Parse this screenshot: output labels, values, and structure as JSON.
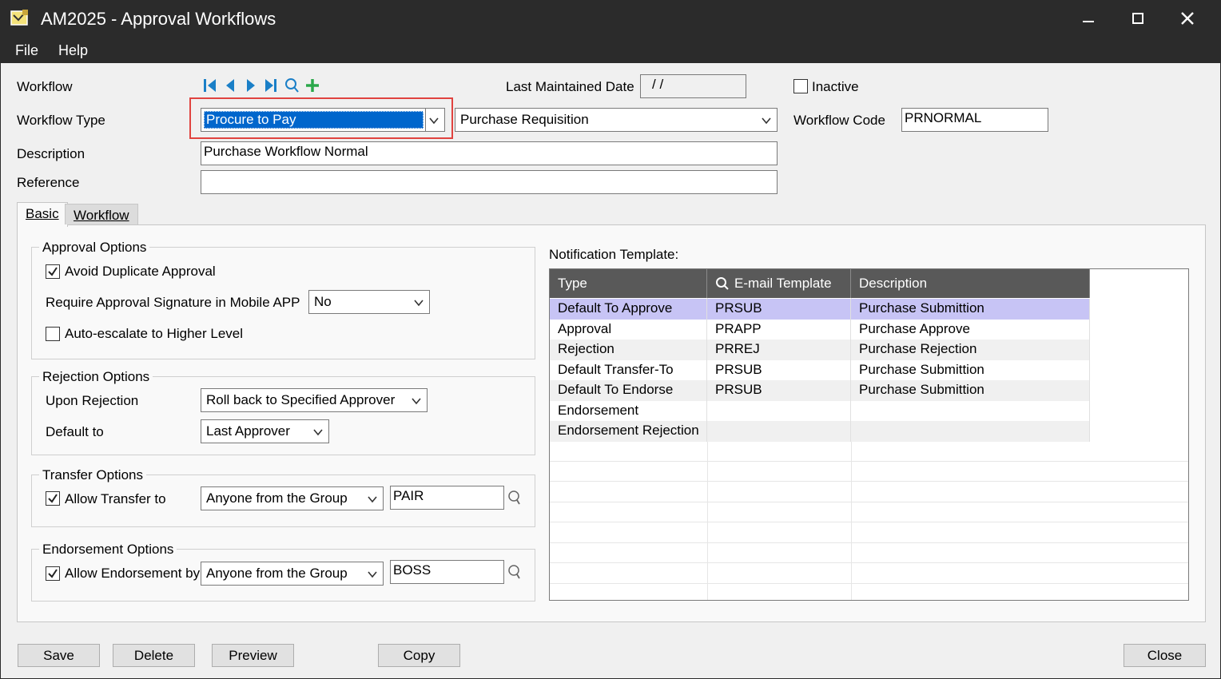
{
  "window": {
    "title": "AM2025 - Approval Workflows",
    "controls": {
      "minimize": "—",
      "maximize": "☐",
      "close": "✕"
    }
  },
  "menu": {
    "file": "File",
    "help": "Help"
  },
  "header": {
    "workflow_label": "Workflow",
    "workflow_type_label": "Workflow Type",
    "workflow_type_value": "Procure to Pay",
    "workflow_subtype_value": "Purchase Requisition",
    "description_label": "Description",
    "description_value": "Purchase Workflow Normal",
    "reference_label": "Reference",
    "reference_value": "",
    "last_maintained_label": "Last Maintained Date",
    "last_maintained_value": " /  /",
    "inactive_label": "Inactive",
    "workflow_code_label": "Workflow Code",
    "workflow_code_value": "PRNORMAL"
  },
  "tabs": {
    "basic": "Basic",
    "workflow": "Workflow"
  },
  "approval": {
    "title": "Approval Options",
    "avoid_duplicate": "Avoid Duplicate Approval",
    "require_signature_label": "Require Approval Signature in Mobile APP",
    "require_signature_value": "No",
    "auto_escalate": "Auto-escalate to Higher Level"
  },
  "rejection": {
    "title": "Rejection Options",
    "upon_label": "Upon Rejection",
    "upon_value": "Roll back to Specified Approver",
    "default_label": "Default to",
    "default_value": "Last Approver"
  },
  "transfer": {
    "title": "Transfer Options",
    "allow_label": "Allow Transfer to",
    "allow_value": "Anyone from the Group",
    "group_value": "PAIR"
  },
  "endorsement": {
    "title": "Endorsement Options",
    "allow_label": "Allow Endorsement by",
    "allow_value": "Anyone from the Group",
    "group_value": "BOSS"
  },
  "notification": {
    "label": "Notification Template:",
    "columns": {
      "type": "Type",
      "template": "E-mail Template",
      "description": "Description"
    },
    "rows": [
      {
        "type": "Default To Approve",
        "template": "PRSUB",
        "description": "Purchase Submittion"
      },
      {
        "type": "Approval",
        "template": "PRAPP",
        "description": "Purchase Approve"
      },
      {
        "type": "Rejection",
        "template": "PRREJ",
        "description": "Purchase Rejection"
      },
      {
        "type": "Default Transfer-To",
        "template": "PRSUB",
        "description": "Purchase Submittion"
      },
      {
        "type": "Default To Endorse",
        "template": "PRSUB",
        "description": "Purchase Submittion"
      },
      {
        "type": "Endorsement",
        "template": "",
        "description": ""
      },
      {
        "type": "Endorsement Rejection",
        "template": "",
        "description": ""
      }
    ]
  },
  "buttons": {
    "save": "Save",
    "delete": "Delete",
    "preview": "Preview",
    "copy": "Copy",
    "close": "Close"
  },
  "colors": {
    "titlebar": "#2b2b2b",
    "selection": "#0066cc",
    "highlight_border": "#e0433f",
    "row_selected": "#c7c4f5",
    "grid_header": "#595959"
  }
}
